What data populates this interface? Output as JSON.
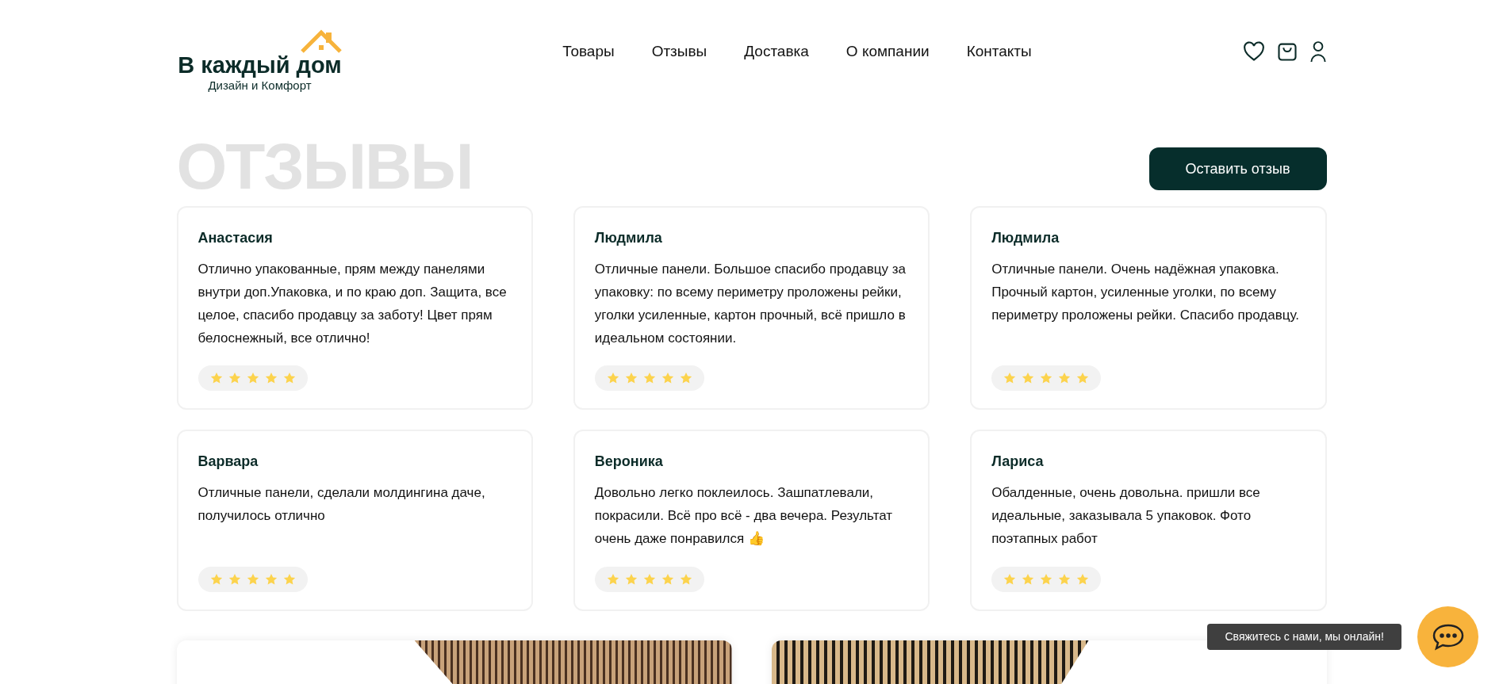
{
  "logo": {
    "title": "В каждый дом",
    "subtitle": "Дизайн и Комфорт"
  },
  "nav": [
    {
      "label": "Товары"
    },
    {
      "label": "Отзывы"
    },
    {
      "label": "Доставка"
    },
    {
      "label": "О компании"
    },
    {
      "label": "Контакты"
    }
  ],
  "page_title": "ОТЗЫВЫ",
  "leave_review_button": "Оставить отзыв",
  "reviews": [
    {
      "name": "Анастасия",
      "text": "Отлично упакованные, прям между панелями внутри доп.Упаковка, и по краю доп. Защита, все целое, спасибо продавцу за заботу! Цвет прям белоснежный, все отлично!",
      "stars": 5
    },
    {
      "name": "Людмила",
      "text": "Отличные панели. Большое спасибо продавцу за упаковку: по всему периметру проложены рейки, уголки усиленные, картон прочный, всё пришло в идеальном состоянии.",
      "stars": 5
    },
    {
      "name": "Людмила",
      "text": "Отличные панели. Очень надёжная упаковка. Прочный картон, усиленные уголки, по всему периметру проложены рейки. Спасибо продавцу.",
      "stars": 5
    },
    {
      "name": "Варвара",
      "text": "Отличные панели, сделали молдингина даче, получилось отлично",
      "stars": 5
    },
    {
      "name": "Вероника",
      "text": "Довольно легко поклеилось. Зашпатлевали, покрасили. Всё про всё - два вечера. Результат очень даже понравился 👍",
      "stars": 5
    },
    {
      "name": "Лариса",
      "text": "Обалденные, очень довольна. пришли все идеальные, заказывала 5 упаковок. Фото поэтапных работ",
      "stars": 5
    }
  ],
  "chat_widget": {
    "tooltip": "Свяжитесь с нами, мы онлайн!"
  }
}
